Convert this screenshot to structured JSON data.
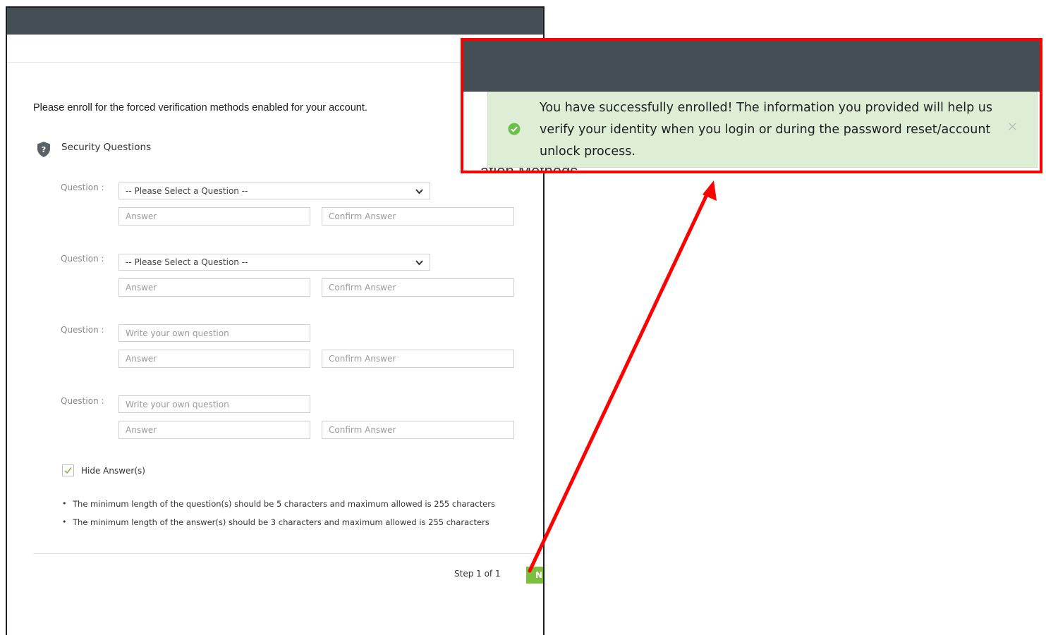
{
  "enrollment": {
    "intro_text": "Please enroll for the forced verification methods enabled for your account.",
    "section_title": "Security Questions",
    "question_label": "Question :",
    "questions": [
      {
        "type": "select",
        "selected": "-- Please Select a Question --"
      },
      {
        "type": "select",
        "selected": "-- Please Select a Question --"
      },
      {
        "type": "custom",
        "placeholder": "Write your own question"
      },
      {
        "type": "custom",
        "placeholder": "Write your own question"
      }
    ],
    "answer_placeholder": "Answer",
    "confirm_placeholder": "Confirm Answer",
    "hide_answers_label": "Hide Answer(s)",
    "hide_answers_checked": true,
    "notes": [
      "The minimum length of the question(s) should be 5 characters and maximum allowed is 255 characters",
      "The minimum length of the answer(s) should be 3 characters and maximum allowed is 255 characters"
    ],
    "step_text": "Step 1 of 1",
    "next_button_label": "N"
  },
  "callout": {
    "behind_text": "ation Methods",
    "alert_message": "You have successfully enrolled! The information you provided will help us verify your identity when you login or during the password reset/account unlock process.",
    "close_symbol": "×"
  },
  "colors": {
    "header": "#434e55",
    "success_bg": "#deedd5",
    "success_icon": "#6cbf4b",
    "next_button": "#7cbf3f",
    "highlight": "#ff0000"
  },
  "icons": [
    "shield-question-icon",
    "chevron-down-icon",
    "check-icon",
    "success-check-icon",
    "close-icon"
  ]
}
